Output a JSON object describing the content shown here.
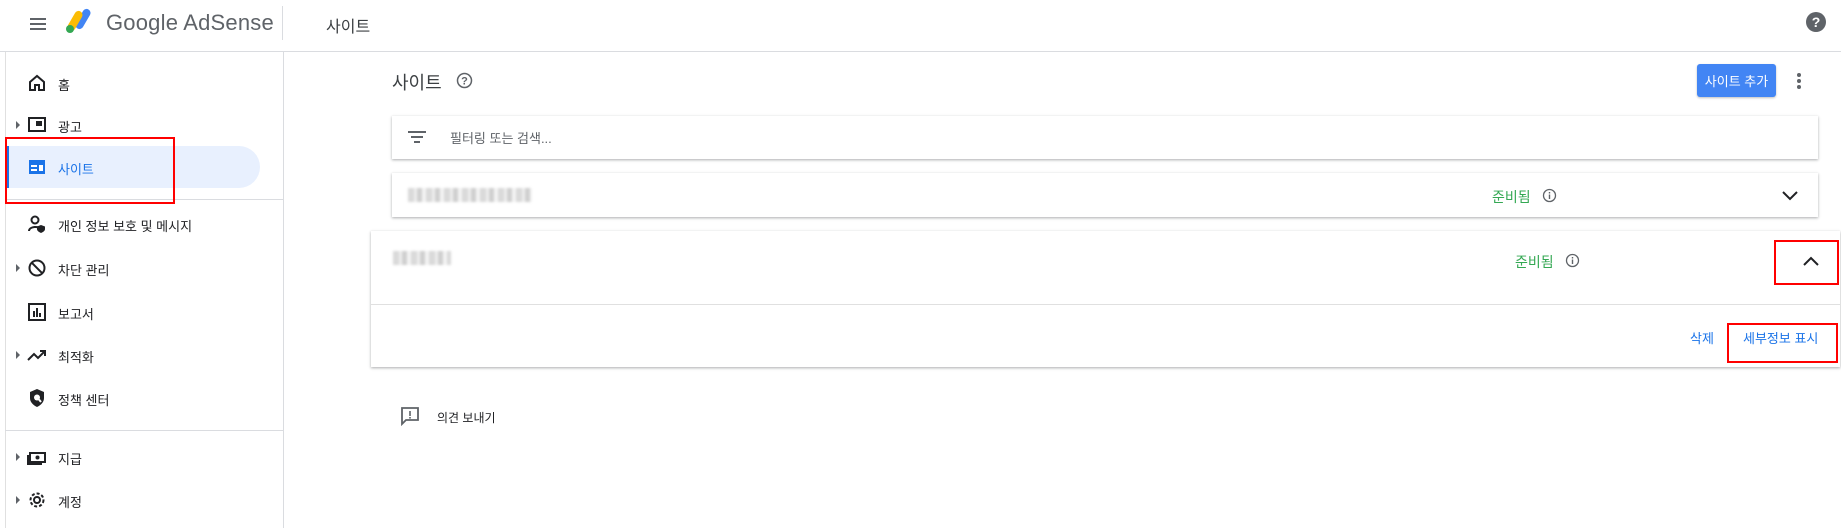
{
  "header": {
    "app_name": "Google AdSense",
    "page_title": "사이트",
    "menu_icon": "hamburger-menu-icon",
    "help_icon": "help-circle-icon",
    "logo_colors": [
      "#fbbc04",
      "#4285f4",
      "#34a853"
    ]
  },
  "sidebar": {
    "items": [
      {
        "label": "홈",
        "icon": "home-icon",
        "expandable": false,
        "active": false
      },
      {
        "label": "광고",
        "icon": "ads-icon",
        "expandable": true,
        "active": false
      },
      {
        "label": "사이트",
        "icon": "sites-icon",
        "expandable": false,
        "active": true
      },
      {
        "label": "개인 정보 보호 및 메시지",
        "icon": "privacy-messaging-icon",
        "expandable": false,
        "active": false
      },
      {
        "label": "차단 관리",
        "icon": "block-icon",
        "expandable": true,
        "active": false
      },
      {
        "label": "보고서",
        "icon": "reports-icon",
        "expandable": false,
        "active": false
      },
      {
        "label": "최적화",
        "icon": "trending-up-icon",
        "expandable": true,
        "active": false
      },
      {
        "label": "정책 센터",
        "icon": "policy-shield-icon",
        "expandable": false,
        "active": false
      },
      {
        "label": "지급",
        "icon": "payments-icon",
        "expandable": true,
        "active": false
      },
      {
        "label": "계정",
        "icon": "settings-gear-icon",
        "expandable": true,
        "active": false
      }
    ]
  },
  "main": {
    "title": "사이트",
    "add_button": "사이트 추가",
    "filter_placeholder": "필터링 또는 검색...",
    "sites": [
      {
        "status": "준비됨",
        "expanded": false
      },
      {
        "status": "준비됨",
        "expanded": true,
        "actions": {
          "delete": "삭제",
          "details": "세부정보 표시"
        }
      }
    ],
    "feedback": "의견 보내기"
  },
  "colors": {
    "accent": "#1a73e8",
    "button": "#4285f4",
    "status_ready": "#34a853",
    "highlight_box": "#ff0000",
    "active_nav_bg": "#e8f0fe"
  }
}
